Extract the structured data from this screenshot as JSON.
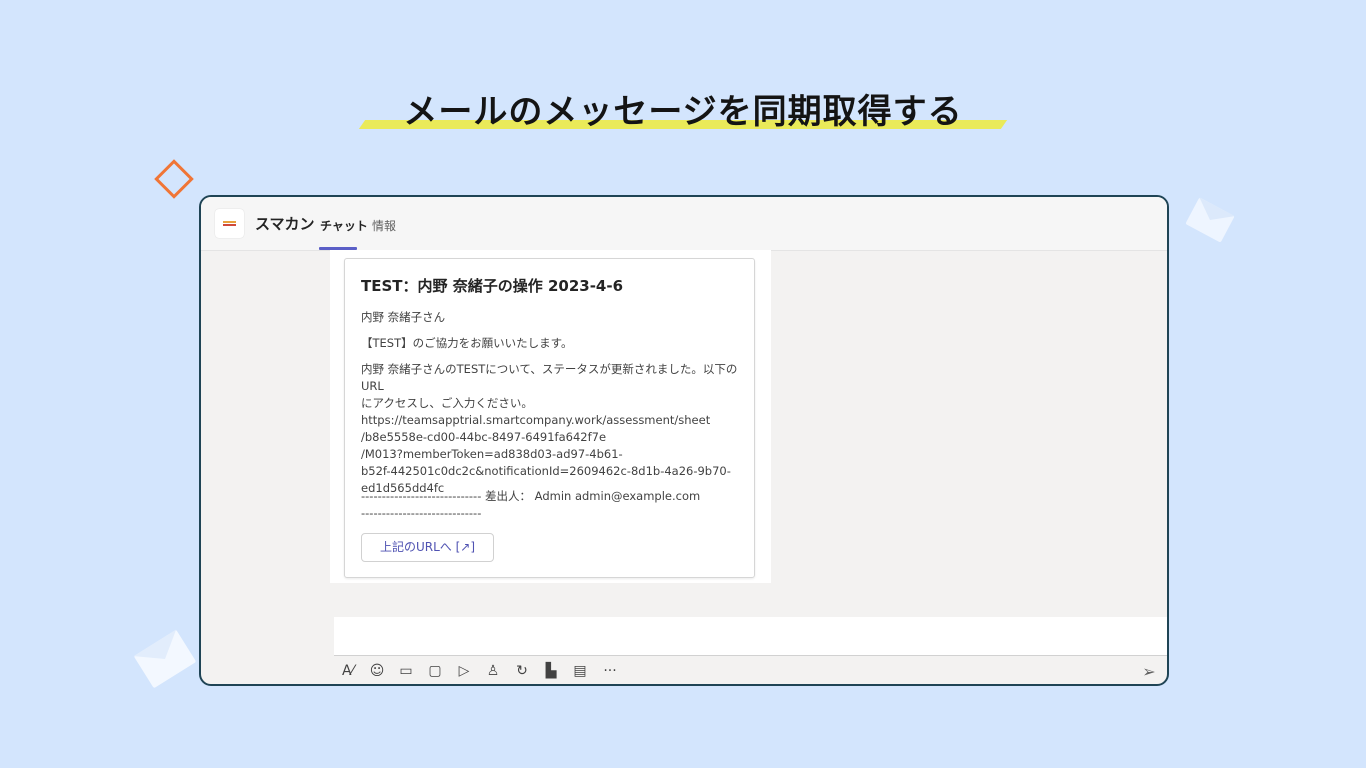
{
  "headline": "メールのメッセージを同期取得する",
  "app": {
    "name": "スマカン",
    "tabs": [
      {
        "label": "チャット",
        "active": true
      },
      {
        "label": "情報",
        "active": false
      }
    ]
  },
  "message_card": {
    "title": "TEST：内野 奈緒子の操作 2023-4-6",
    "greeting": "内野 奈緒子さん",
    "request": "【TEST】のご協力をお願いいたします。",
    "body_lines": [
      "内野 奈緒子さんのTESTについて、ステータスが更新されました。以下のURL",
      "にアクセスし、ご入力ください。",
      "https://teamsapptrial.smartcompany.work/assessment/sheet",
      "/b8e5558e-cd00-44bc-8497-6491fa642f7e",
      "/M013?memberToken=ad838d03-ad97-4b61-",
      "b52f-442501c0dc2c&notificationId=2609462c-8d1b-4a26-9b70-",
      "ed1d565dd4fc"
    ],
    "sender_lines": [
      "----------------------------- 差出人： Admin admin@example.com",
      "-----------------------------"
    ],
    "button_label": "上記のURLへ [↗]"
  },
  "compose_toolbar": {
    "icons": [
      {
        "name": "format-icon",
        "glyph": "A⁄"
      },
      {
        "name": "emoji-icon",
        "glyph": "☺"
      },
      {
        "name": "gif-icon",
        "glyph": "▭"
      },
      {
        "name": "sticker-icon",
        "glyph": "▢"
      },
      {
        "name": "meet-now-icon",
        "glyph": "▷"
      },
      {
        "name": "praise-icon",
        "glyph": "♙"
      },
      {
        "name": "loop-icon",
        "glyph": "↻"
      },
      {
        "name": "approvals-icon",
        "glyph": "▙"
      },
      {
        "name": "forms-icon",
        "glyph": "▤"
      },
      {
        "name": "more-options-icon",
        "glyph": "···"
      }
    ],
    "send_icon": "➢"
  },
  "colors": {
    "background": "#d3e5fd",
    "highlight": "#eaea59",
    "accent": "#5b5fc7",
    "diamond": "#f07536",
    "window_border": "#1f4455"
  }
}
